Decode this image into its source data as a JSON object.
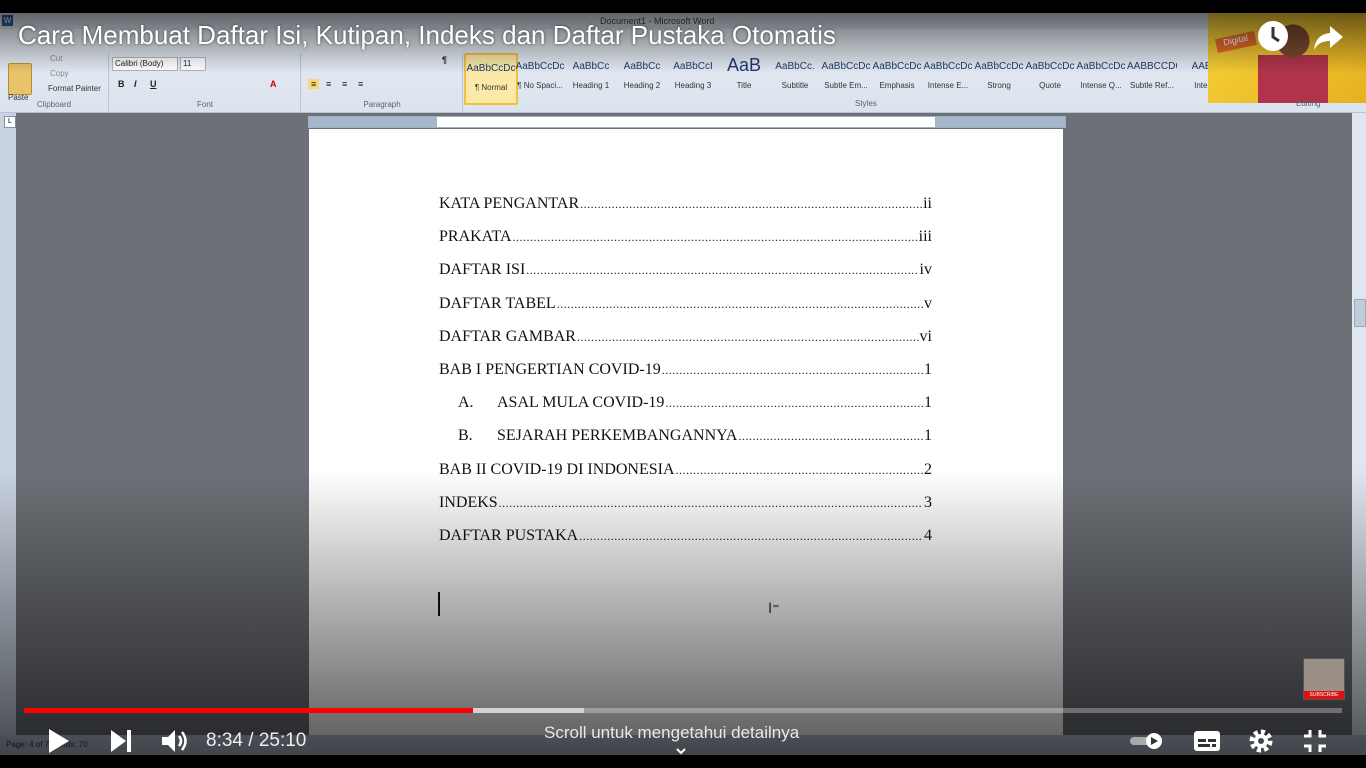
{
  "video": {
    "title": "Cara Membuat Daftar Isi, Kutipan, Indeks dan Daftar Pustaka Otomatis",
    "current_time": "8:34",
    "duration": "25:10",
    "time_display": "8:34 / 25:10",
    "progress": 0.341,
    "buffered": 0.425,
    "scroll_hint": "Scroll untuk mengetahui detailnya",
    "subscribe_label": "SUBSCRIBE"
  },
  "word": {
    "window_title": "Document1 - Microsoft Word",
    "clipboard": {
      "paste": "Paste",
      "cut": "Cut",
      "copy": "Copy",
      "format_painter": "Format Painter",
      "label": "Clipboard"
    },
    "font": {
      "name": "Calibri (Body)",
      "size": "11",
      "label": "Font"
    },
    "paragraph": {
      "label": "Paragraph"
    },
    "styles_label": "Styles",
    "editing_label": "Editing",
    "styles": [
      {
        "sample": "AaBbCcDc",
        "name": "¶ Normal"
      },
      {
        "sample": "AaBbCcDc",
        "name": "¶ No Spaci..."
      },
      {
        "sample": "AaBbCc",
        "name": "Heading 1"
      },
      {
        "sample": "AaBbCc",
        "name": "Heading 2"
      },
      {
        "sample": "AaBbCcI",
        "name": "Heading 3"
      },
      {
        "sample": "AaB",
        "name": "Title"
      },
      {
        "sample": "AaBbCc.",
        "name": "Subtitle"
      },
      {
        "sample": "AaBbCcDc",
        "name": "Subtle Em..."
      },
      {
        "sample": "AaBbCcDc",
        "name": "Emphasis"
      },
      {
        "sample": "AaBbCcDc",
        "name": "Intense E..."
      },
      {
        "sample": "AaBbCcDc",
        "name": "Strong"
      },
      {
        "sample": "AaBbCcDc",
        "name": "Quote"
      },
      {
        "sample": "AaBbCcDc",
        "name": "Intense Q..."
      },
      {
        "sample": "AABBCCDC",
        "name": "Subtle Ref..."
      },
      {
        "sample": "AABI",
        "name": "Inten"
      }
    ],
    "status_text": "Page: 4 of 7   Words: 70"
  },
  "toc": [
    {
      "letter": "",
      "text": "KATA PENGANTAR",
      "page": "ii"
    },
    {
      "letter": "",
      "text": "PRAKATA",
      "page": "iii"
    },
    {
      "letter": "",
      "text": "DAFTAR ISI",
      "page": "iv"
    },
    {
      "letter": "",
      "text": "DAFTAR TABEL",
      "page": "v"
    },
    {
      "letter": "",
      "text": "DAFTAR GAMBAR",
      "page": "vi"
    },
    {
      "letter": "",
      "text": "BAB I PENGERTIAN COVID-19",
      "page": "1"
    },
    {
      "letter": "A.",
      "text": "ASAL MULA COVID-19",
      "page": "1"
    },
    {
      "letter": "B.",
      "text": "SEJARAH PERKEMBANGANNYA",
      "page": "1"
    },
    {
      "letter": "",
      "text": "BAB II COVID-19 DI INDONESIA",
      "page": "2"
    },
    {
      "letter": "",
      "text": "INDEKS",
      "page": "3"
    },
    {
      "letter": "",
      "text": "DAFTAR PUSTAKA",
      "page": "4"
    }
  ],
  "colors": {
    "progress_played": "#ff0000",
    "ribbon_bg": "#dbe3ee",
    "page_bg": "#ffffff"
  }
}
